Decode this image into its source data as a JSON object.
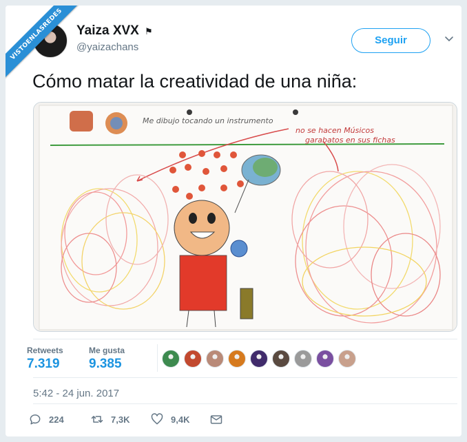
{
  "watermark": {
    "text": "VISTOENLASREDES"
  },
  "author": {
    "display_name": "Yaiza XVX",
    "flag_icon": "flag-icon",
    "handle": "@yaizachans"
  },
  "follow_button": {
    "label": "Seguir"
  },
  "tweet": {
    "text": "Cómo matar la creatividad de una niña:"
  },
  "media": {
    "drawing_header": "Me dibujo tocando un instrumento",
    "note_line1": "no se hacen Músicos",
    "note_line2": "garabatos en sus fichas"
  },
  "stats": {
    "retweets_label": "Retweets",
    "retweets_value": "7.319",
    "likes_label": "Me gusta",
    "likes_value": "9.385"
  },
  "likers": [
    {
      "name": "liker-1",
      "color": "#3d8a4f"
    },
    {
      "name": "liker-2",
      "color": "#c2492f"
    },
    {
      "name": "liker-3",
      "color": "#b98a78"
    },
    {
      "name": "liker-4",
      "color": "#d67a1e"
    },
    {
      "name": "liker-5",
      "color": "#402b6b"
    },
    {
      "name": "liker-6",
      "color": "#5a4a40"
    },
    {
      "name": "liker-7",
      "color": "#9a9a9a"
    },
    {
      "name": "liker-8",
      "color": "#7a4fa0"
    },
    {
      "name": "liker-9",
      "color": "#c8a08c"
    }
  ],
  "timestamp": "5:42 - 24 jun. 2017",
  "actions": {
    "reply_count": "224",
    "retweet_count": "7,3K",
    "like_count": "9,4K"
  },
  "colors": {
    "accent": "#1da1f2",
    "stat_value": "#1c94e0",
    "muted": "#657786",
    "ribbon": "#2a8fd6"
  }
}
